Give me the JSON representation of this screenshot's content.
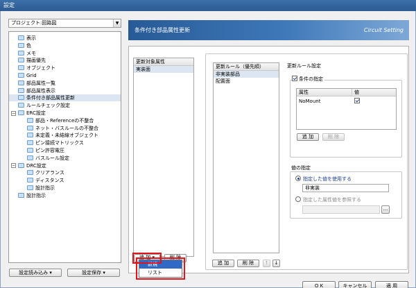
{
  "window": {
    "title": "設定"
  },
  "left": {
    "combo_value": "プロジェクト:回路図",
    "tree": [
      {
        "label": "表示",
        "depth": 0,
        "toggle": "",
        "selected": false
      },
      {
        "label": "色",
        "depth": 0,
        "toggle": "",
        "selected": false
      },
      {
        "label": "メモ",
        "depth": 0,
        "toggle": "",
        "selected": false
      },
      {
        "label": "描画優先",
        "depth": 0,
        "toggle": "",
        "selected": false
      },
      {
        "label": "オブジェクト",
        "depth": 0,
        "toggle": "",
        "selected": false
      },
      {
        "label": "Grid",
        "depth": 0,
        "toggle": "",
        "selected": false
      },
      {
        "label": "部品属性一覧",
        "depth": 0,
        "toggle": "",
        "selected": false
      },
      {
        "label": "部品属性表示",
        "depth": 0,
        "toggle": "",
        "selected": false
      },
      {
        "label": "条件付き部品属性更新",
        "depth": 0,
        "toggle": "",
        "selected": true
      },
      {
        "label": "ルールチェック設定",
        "depth": 0,
        "toggle": "",
        "selected": false
      },
      {
        "label": "ERC設定",
        "depth": 0,
        "toggle": "−",
        "selected": false
      },
      {
        "label": "部品・Referenceの不整合",
        "depth": 1,
        "toggle": "",
        "selected": false
      },
      {
        "label": "ネット・バスルールの不整合",
        "depth": 1,
        "toggle": "",
        "selected": false
      },
      {
        "label": "未定義・未結線オブジェクト",
        "depth": 1,
        "toggle": "",
        "selected": false
      },
      {
        "label": "ピン接続マトリックス",
        "depth": 1,
        "toggle": "",
        "selected": false
      },
      {
        "label": "ピン許容電圧",
        "depth": 1,
        "toggle": "",
        "selected": false
      },
      {
        "label": "バスルール設定",
        "depth": 1,
        "toggle": "",
        "selected": false
      },
      {
        "label": "DRC設定",
        "depth": 0,
        "toggle": "−",
        "selected": false
      },
      {
        "label": "クリアランス",
        "depth": 1,
        "toggle": "",
        "selected": false
      },
      {
        "label": "ディスタンス",
        "depth": 1,
        "toggle": "",
        "selected": false
      },
      {
        "label": "設計指示",
        "depth": 1,
        "toggle": "",
        "selected": false
      },
      {
        "label": "設計指示",
        "depth": 0,
        "toggle": "",
        "selected": false
      }
    ],
    "load_label": "設定読み込み ▾",
    "save_label": "設定保存 ▾"
  },
  "banner": {
    "title": "条件付き部品属性更新",
    "subtitle": "Circuit Setting"
  },
  "target_list": {
    "header": "更新対象属性",
    "items": [
      {
        "label": "実装面",
        "selected": true
      }
    ]
  },
  "rules_list": {
    "header": "更新ルール（優先順）",
    "items": [
      {
        "label": "非実装部品",
        "selected": true
      },
      {
        "label": "配置面",
        "selected": false
      }
    ]
  },
  "rule_settings": {
    "title": "更新ルール設定",
    "condition_label": "条件の指定",
    "table_headers": {
      "attr": "属性",
      "value": "値"
    },
    "rows": [
      {
        "attr": "NoMount",
        "checked": true
      }
    ],
    "add": "追 加",
    "del": "削 除",
    "value_group": "値の指定",
    "use_value_label": "指定した値を使用する",
    "value": "非実装",
    "ref_attr_label": "指定した属性値を参照する",
    "browse": "..."
  },
  "buttons": {
    "target_add": "追 加 ▾",
    "target_del": "削 除",
    "rules_add": "追 加",
    "rules_del": "削 除",
    "up": "↑",
    "down": "↓",
    "ok": "O K",
    "cancel": "キャンセル",
    "apply": "適 用"
  },
  "menu": {
    "items": [
      {
        "label": "新規",
        "highlighted": true
      },
      {
        "label": "リスト",
        "highlighted": false
      }
    ]
  },
  "colors": {
    "highlight_box": "#e0141c",
    "selection": "#dce6f2",
    "banner": "#275a96"
  }
}
